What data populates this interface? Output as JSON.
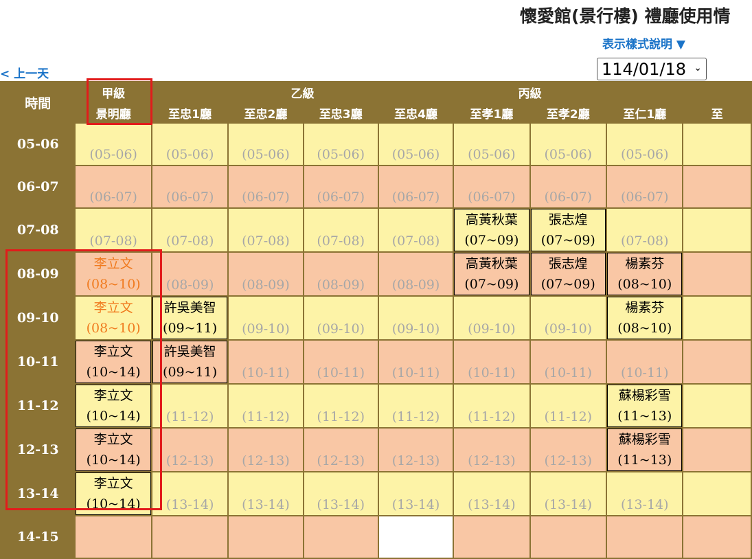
{
  "header": {
    "title": "懷愛館(景行樓) 禮廳使用情",
    "legend_link": "表示樣式說明 ▼",
    "prev_day": "< 上一天",
    "date_value": "114/01/18"
  },
  "table": {
    "corner_label": "時間",
    "groups": [
      "甲級",
      "乙級",
      "丙級",
      ""
    ],
    "rooms": [
      "景明廳",
      "至忠1廳",
      "至忠2廳",
      "至忠3廳",
      "至忠4廳",
      "至孝1廳",
      "至孝2廳",
      "至仁1廳",
      "至"
    ],
    "rows": [
      {
        "time": "05-06",
        "cells": [
          {
            "text": "(05-06)"
          },
          {
            "text": "(05-06)"
          },
          {
            "text": "(05-06)"
          },
          {
            "text": "(05-06)"
          },
          {
            "text": "(05-06)"
          },
          {
            "text": "(05-06)"
          },
          {
            "text": "(05-06)"
          },
          {
            "text": "(05-06)"
          },
          {
            "text": ""
          }
        ]
      },
      {
        "time": "06-07",
        "cells": [
          {
            "text": "(06-07)"
          },
          {
            "text": "(06-07)"
          },
          {
            "text": "(06-07)"
          },
          {
            "text": "(06-07)"
          },
          {
            "text": "(06-07)"
          },
          {
            "text": "(06-07)"
          },
          {
            "text": "(06-07)"
          },
          {
            "text": "(06-07)"
          },
          {
            "text": ""
          }
        ]
      },
      {
        "time": "07-08",
        "cells": [
          {
            "text": "(07-08)"
          },
          {
            "text": "(07-08)"
          },
          {
            "text": "(07-08)"
          },
          {
            "text": "(07-08)"
          },
          {
            "text": "(07-08)"
          },
          {
            "name": "高黃秋葉",
            "span": "(07~09)"
          },
          {
            "name": "張志煌",
            "span": "(07~09)"
          },
          {
            "text": "(07-08)"
          },
          {
            "text": ""
          }
        ]
      },
      {
        "time": "08-09",
        "cells": [
          {
            "ghost_name": "李立文",
            "ghost_span": "(08~10)"
          },
          {
            "text": "(08-09)"
          },
          {
            "text": "(08-09)"
          },
          {
            "text": "(08-09)"
          },
          {
            "text": "(08-09)"
          },
          {
            "name": "高黃秋葉",
            "span": "(07~09)"
          },
          {
            "name": "張志煌",
            "span": "(07~09)"
          },
          {
            "name": "楊素芬",
            "span": "(08~10)"
          },
          {
            "text": ""
          }
        ]
      },
      {
        "time": "09-10",
        "cells": [
          {
            "ghost_name": "李立文",
            "ghost_span": "(08~10)"
          },
          {
            "name": "許吳美智",
            "span": "(09~11)"
          },
          {
            "text": "(09-10)"
          },
          {
            "text": "(09-10)"
          },
          {
            "text": "(09-10)"
          },
          {
            "text": "(09-10)"
          },
          {
            "text": "(09-10)"
          },
          {
            "name": "楊素芬",
            "span": "(08~10)"
          },
          {
            "text": ""
          }
        ]
      },
      {
        "time": "10-11",
        "cells": [
          {
            "name": "李立文",
            "span": "(10~14)"
          },
          {
            "name": "許吳美智",
            "span": "(09~11)"
          },
          {
            "text": "(10-11)"
          },
          {
            "text": "(10-11)"
          },
          {
            "text": "(10-11)"
          },
          {
            "text": "(10-11)"
          },
          {
            "text": "(10-11)"
          },
          {
            "text": "(10-11)"
          },
          {
            "text": ""
          }
        ]
      },
      {
        "time": "11-12",
        "cells": [
          {
            "name": "李立文",
            "span": "(10~14)"
          },
          {
            "text": "(11-12)"
          },
          {
            "text": "(11-12)"
          },
          {
            "text": "(11-12)"
          },
          {
            "text": "(11-12)"
          },
          {
            "text": "(11-12)"
          },
          {
            "text": "(11-12)"
          },
          {
            "name": "蘇楊彩雪",
            "span": "(11~13)"
          },
          {
            "text": ""
          }
        ]
      },
      {
        "time": "12-13",
        "cells": [
          {
            "name": "李立文",
            "span": "(10~14)"
          },
          {
            "text": "(12-13)"
          },
          {
            "text": "(12-13)"
          },
          {
            "text": "(12-13)"
          },
          {
            "text": "(12-13)"
          },
          {
            "text": "(12-13)"
          },
          {
            "text": "(12-13)"
          },
          {
            "name": "蘇楊彩雪",
            "span": "(11~13)"
          },
          {
            "text": ""
          }
        ]
      },
      {
        "time": "13-14",
        "cells": [
          {
            "name": "李立文",
            "span": "(10~14)"
          },
          {
            "text": "(13-14)"
          },
          {
            "text": "(13-14)"
          },
          {
            "text": "(13-14)"
          },
          {
            "text": "(13-14)"
          },
          {
            "text": "(13-14)"
          },
          {
            "text": "(13-14)"
          },
          {
            "text": "(13-14)"
          },
          {
            "text": ""
          }
        ]
      },
      {
        "time": "14-15",
        "cells": [
          {
            "text": ""
          },
          {
            "text": ""
          },
          {
            "text": ""
          },
          {
            "text": ""
          },
          {
            "text": "",
            "white": true
          },
          {
            "text": ""
          },
          {
            "text": ""
          },
          {
            "text": ""
          },
          {
            "text": ""
          }
        ]
      }
    ]
  }
}
